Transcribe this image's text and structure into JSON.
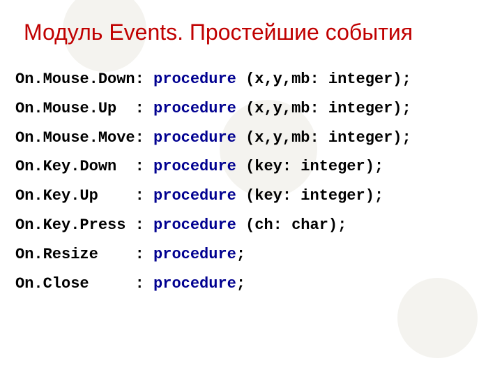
{
  "title": "Модуль Events. Простейшие события",
  "kw": "procedure",
  "rows": [
    {
      "pre": "On.Mouse.Down: ",
      "rest": " (x,y,mb: integer);"
    },
    {
      "pre": "On.Mouse.Up  : ",
      "rest": " (x,y,mb: integer);"
    },
    {
      "pre": "On.Mouse.Move: ",
      "rest": " (x,y,mb: integer);"
    },
    {
      "pre": "On.Key.Down  : ",
      "rest": " (key: integer);"
    },
    {
      "pre": "On.Key.Up    : ",
      "rest": " (key: integer);"
    },
    {
      "pre": "On.Key.Press : ",
      "rest": " (ch: char);"
    },
    {
      "pre": "On.Resize    : ",
      "rest": ";"
    },
    {
      "pre": "On.Close     : ",
      "rest": ";"
    }
  ]
}
